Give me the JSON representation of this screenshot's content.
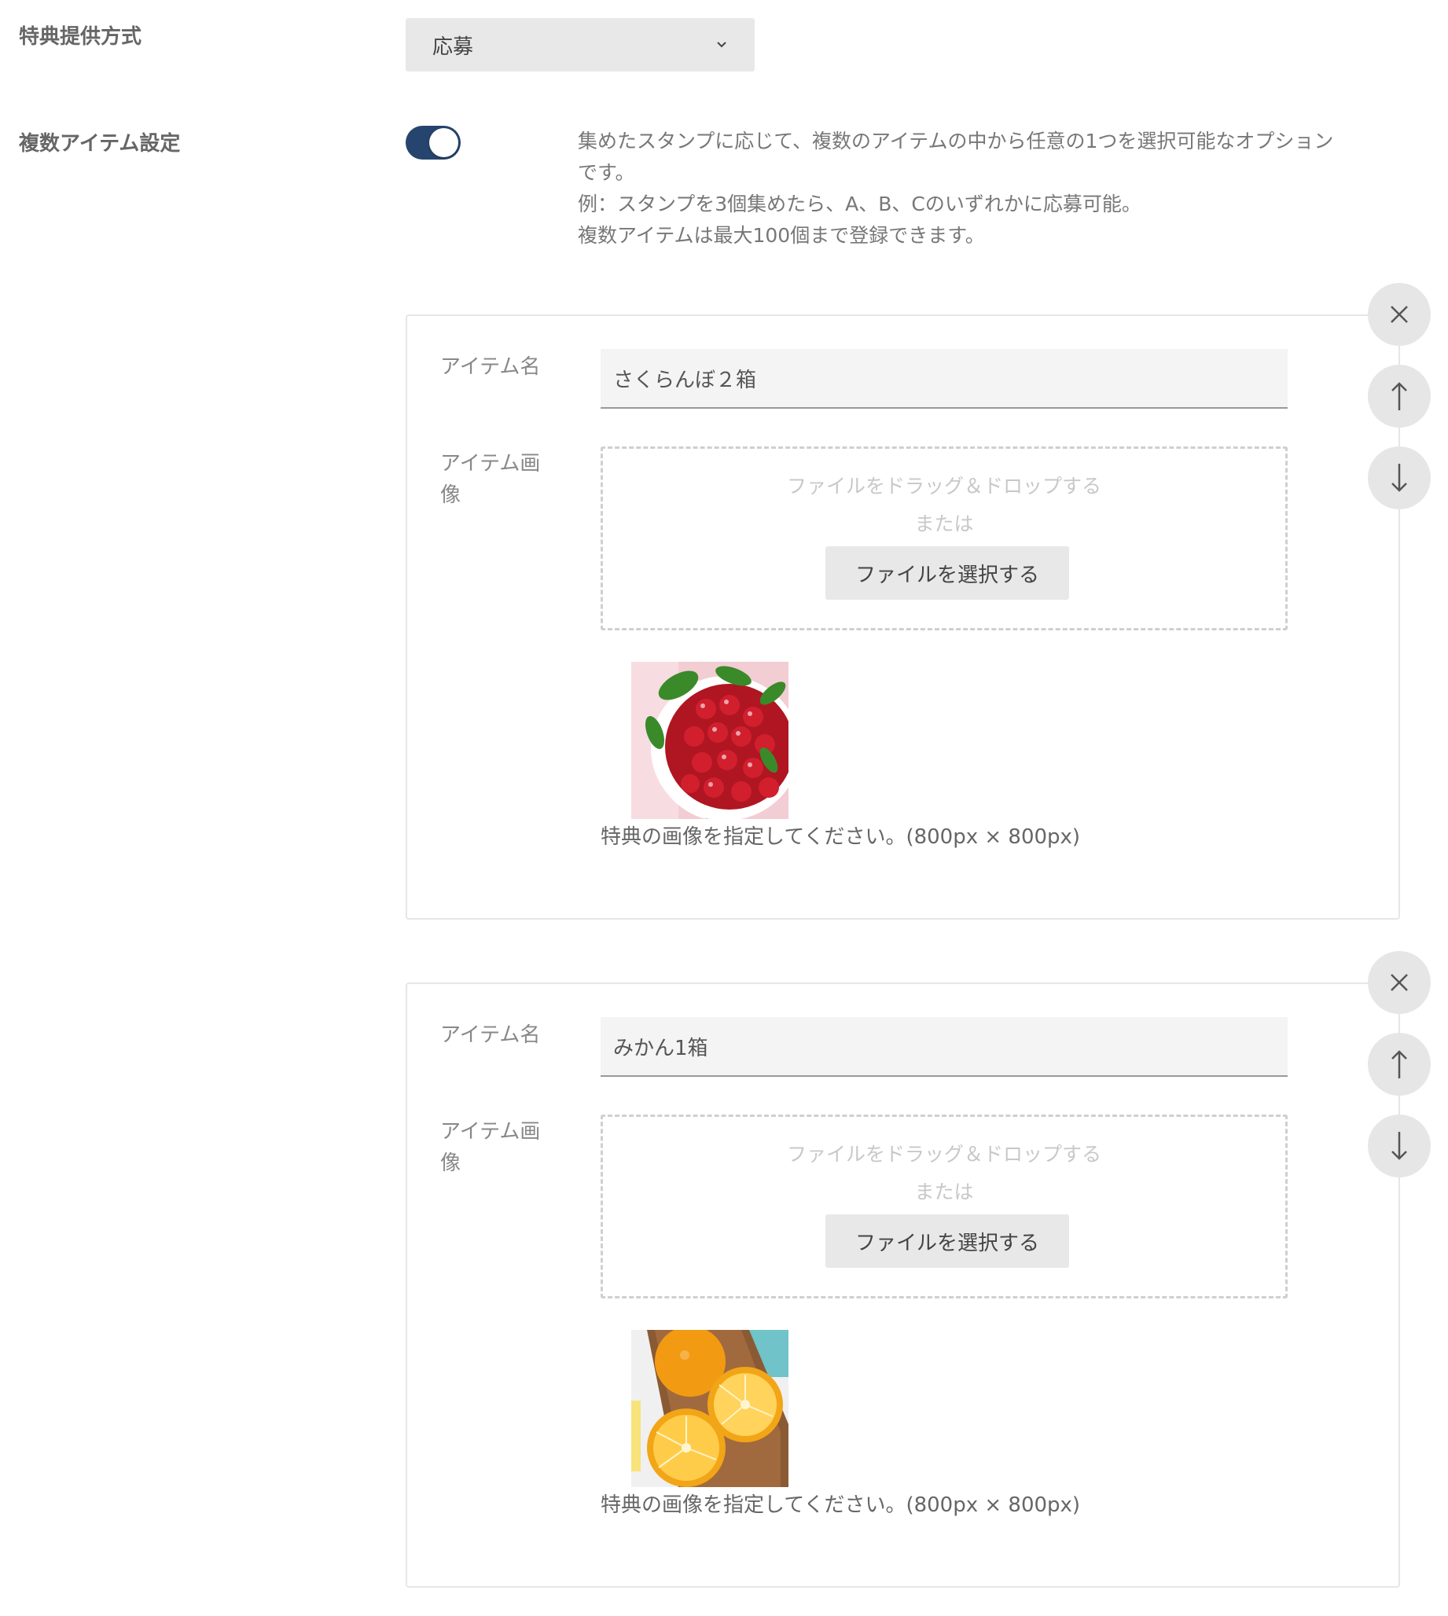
{
  "benefit_method": {
    "label": "特典提供方式",
    "selected": "応募"
  },
  "multi_item": {
    "label": "複数アイテム設定",
    "toggle_on": true,
    "description": [
      "集めたスタンプに応じて、複数のアイテムの中から任意の1つを選択可能なオプション",
      "です。",
      "例：スタンプを3個集めたら、A、B、Cのいずれかに応募可能。",
      "複数アイテムは最大100個まで登録できます。"
    ]
  },
  "items": [
    {
      "name_label": "アイテム名",
      "name_value": "さくらんぼ２箱",
      "image_label": "アイテム画像",
      "drop_text": "ファイルをドラッグ＆ドロップする",
      "or_text": "または",
      "select_button": "ファイルを選択する",
      "image_hint": "特典の画像を指定してください。(800px × 800px)",
      "image_icon": "cherries-photo"
    },
    {
      "name_label": "アイテム名",
      "name_value": "みかん1箱",
      "image_label": "アイテム画像",
      "drop_text": "ファイルをドラッグ＆ドロップする",
      "or_text": "または",
      "select_button": "ファイルを選択する",
      "image_hint": "特典の画像を指定してください。(800px × 800px)",
      "image_icon": "oranges-photo"
    }
  ],
  "colors": {
    "toggle_on": "#26456e",
    "button_bg": "#e8e8e8",
    "border": "#e6e6e6"
  }
}
